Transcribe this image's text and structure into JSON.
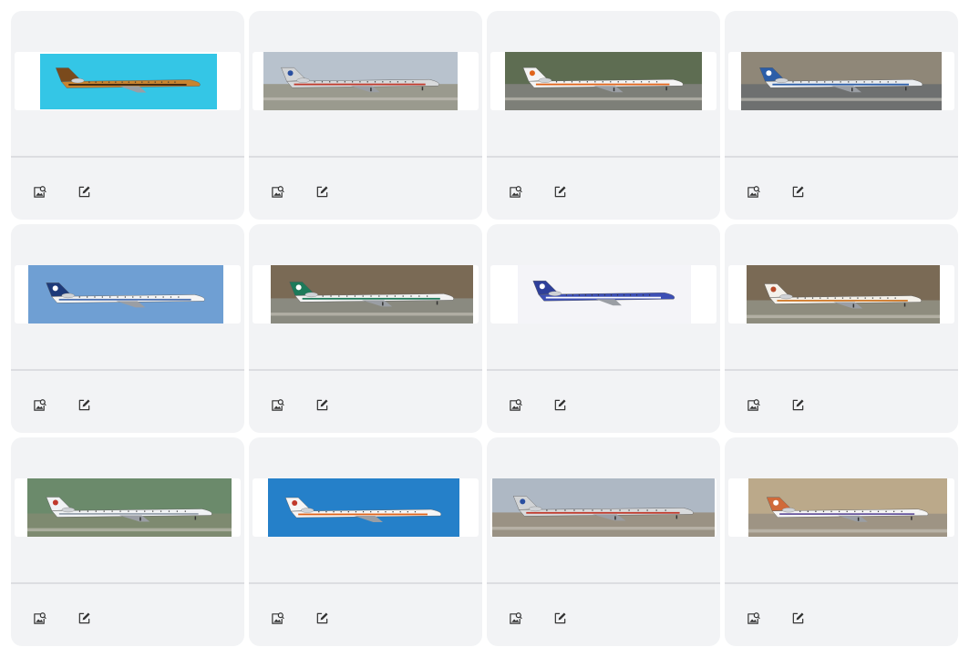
{
  "gallery": {
    "actions": {
      "image_icon": "image-search-icon",
      "edit_icon": "edit-icon"
    },
    "cards": [
      {
        "subject": "tiger-striped-jet",
        "bg": "#34c6e6",
        "ground": "",
        "fuselage": "#c8842f",
        "tail": "#7a4a1c",
        "stripe": "#3b2410",
        "tailmark": ""
      },
      {
        "subject": "american-airlines-md80",
        "bg": "#b8c2cd",
        "ground": "#9a9a8e",
        "fuselage": "#d8dadc",
        "tail": "#d2d4d6",
        "stripe": "#c0392b",
        "tailmark": "#2a4fa0"
      },
      {
        "subject": "spanair-md80",
        "bg": "#5e6d52",
        "ground": "#7d7f78",
        "fuselage": "#f4f4f4",
        "tail": "#f4f4f4",
        "stripe": "#e0641a",
        "tailmark": "#e0641a"
      },
      {
        "subject": "midway-md80",
        "bg": "#8f8778",
        "ground": "#6e7070",
        "fuselage": "#e9ecef",
        "tail": "#2c5ea8",
        "stripe": "#2c5ea8",
        "tailmark": "#ffffff"
      },
      {
        "subject": "continental-md80",
        "bg": "#6f9fd3",
        "ground": "",
        "fuselage": "#f5f5f5",
        "tail": "#1d3a7a",
        "stripe": "#4a6fb0",
        "tailmark": "#ffffff"
      },
      {
        "subject": "mexicana-727",
        "bg": "#7a6a55",
        "ground": "#8a8a80",
        "fuselage": "#f2f2f2",
        "tail": "#1d7a5a",
        "stripe": "#1d7a5a",
        "tailmark": "#ffffff"
      },
      {
        "subject": "corsair-fighter",
        "bg": "#f4f4f8",
        "ground": "",
        "fuselage": "#3c4fb5",
        "tail": "#2e3f9a",
        "stripe": "#ffffff",
        "tailmark": "#ffffff"
      },
      {
        "subject": "sun-country-727",
        "bg": "#7a6a55",
        "ground": "#8e8c7e",
        "fuselage": "#f4f1ea",
        "tail": "#f4f1ea",
        "stripe": "#d07a2a",
        "tailmark": "#b84a2a"
      },
      {
        "subject": "british-airways-concorde",
        "bg": "#6b8a6b",
        "ground": "#7e8a70",
        "fuselage": "#f0f2f4",
        "tail": "#f0f2f4",
        "stripe": "#9aa4b0",
        "tailmark": "#c0392b"
      },
      {
        "subject": "iberia-md87",
        "bg": "#2580c9",
        "ground": "",
        "fuselage": "#f5f5f5",
        "tail": "#f5f5f5",
        "stripe": "#e0641a",
        "tailmark": "#c0392b"
      },
      {
        "subject": "american-airlines-md80-2",
        "bg": "#aeb8c4",
        "ground": "#9a9284",
        "fuselage": "#d8dadc",
        "tail": "#d2d4d6",
        "stripe": "#c0392b",
        "tailmark": "#2a4fa0"
      },
      {
        "subject": "british-airways-crj",
        "bg": "#bba98a",
        "ground": "#9e9484",
        "fuselage": "#f5f5f5",
        "tail": "#d06a3a",
        "stripe": "#6a5aa0",
        "tailmark": "#ffffff"
      }
    ]
  }
}
